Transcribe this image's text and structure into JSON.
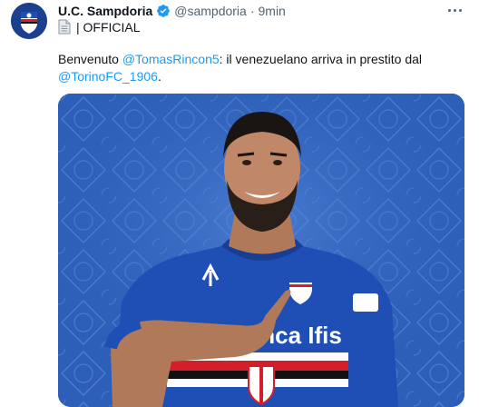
{
  "tweet": {
    "author_name": "U.C. Sampdoria",
    "handle": "@sampdoria",
    "separator": "·",
    "time": "9min",
    "line2_text": "| OFFICIAL",
    "body": {
      "part1": "Benvenuto ",
      "mention1": "@TomasRincon5",
      "part2": ": il venezuelano arriva in prestito dal ",
      "mention2": "@TorinoFC_1906",
      "part3": "."
    },
    "media_alt": "Player in Sampdoria kit pointing at the club crest",
    "shirt_sponsor": "Banca Ifis"
  },
  "icons": {
    "verified": "verified-badge-icon",
    "more": "more-options-icon",
    "document": "document-icon"
  },
  "colors": {
    "link": "#1d9bf0",
    "verified": "#1d9bf0",
    "muted": "#536471",
    "kit_blue": "#1f4fb5",
    "media_bg": "#2d5fb8"
  }
}
